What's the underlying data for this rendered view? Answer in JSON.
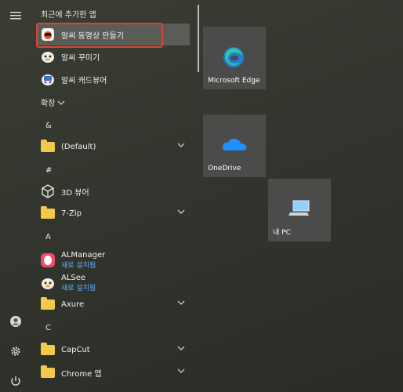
{
  "recent_header": "최근에 추가한 앱",
  "recent_apps": [
    {
      "label": "알씨 동영상 만들기"
    },
    {
      "label": "알씨 꾸미기"
    },
    {
      "label": "알씨 캐드뷰어"
    }
  ],
  "expand_label": "확장",
  "groups": {
    "amp": "&",
    "hash": "#",
    "a": "A",
    "c": "C"
  },
  "apps": {
    "default_folder": "(Default)",
    "viewer3d": "3D 뷰어",
    "zip": "7-Zip",
    "almanager": "ALManager",
    "almanager_sub": "새로 설치됨",
    "alsee": "ALSee",
    "alsee_sub": "새로 설치됨",
    "axure": "Axure",
    "capcut": "CapCut",
    "chrome": "Chrome 앱"
  },
  "tiles": {
    "edge": "Microsoft Edge",
    "onedrive": "OneDrive",
    "mypc": "내 PC"
  },
  "colors": {
    "highlight_border": "#d9443b",
    "folder": "#f2c94c",
    "new_badge": "#5ab4ff"
  }
}
